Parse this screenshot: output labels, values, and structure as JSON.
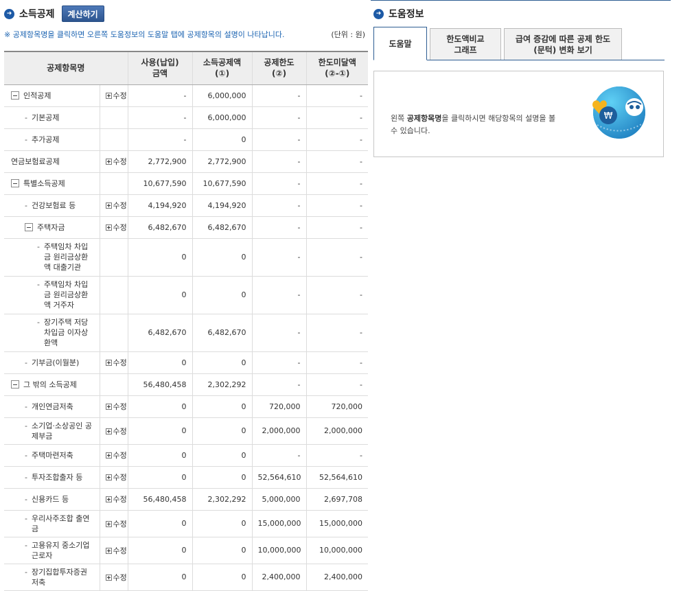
{
  "header": {
    "title": "소득공제",
    "calc_button": "계산하기",
    "note": "※ 공제항목명을 클릭하면 오른쪽 도움정보의 도움말 탭에 공제항목의 설명이 나타납니다.",
    "unit": "(단위 : 원)"
  },
  "table": {
    "headers": {
      "item": "공제항목명",
      "used_1": "사용(납입)",
      "used_2": "금액",
      "deduct_1": "소득공제액",
      "deduct_2": "(①)",
      "limit_1": "공제한도",
      "limit_2": "(②)",
      "remain_1": "한도미달액",
      "remain_2": "(②-①)"
    },
    "edit_label": "수정",
    "rows": [
      {
        "name": "인적공제",
        "used": "-",
        "deduct": "6,000,000",
        "limit": "-",
        "remain": "-"
      },
      {
        "name": "기본공제",
        "used": "-",
        "deduct": "6,000,000",
        "limit": "-",
        "remain": "-"
      },
      {
        "name": "추가공제",
        "used": "-",
        "deduct": "0",
        "limit": "-",
        "remain": "-"
      },
      {
        "name": "연금보험료공제",
        "used": "2,772,900",
        "deduct": "2,772,900",
        "limit": "-",
        "remain": "-"
      },
      {
        "name": "특별소득공제",
        "used": "10,677,590",
        "deduct": "10,677,590",
        "limit": "-",
        "remain": "-"
      },
      {
        "name": "건강보험료 등",
        "used": "4,194,920",
        "deduct": "4,194,920",
        "limit": "-",
        "remain": "-"
      },
      {
        "name": "주택자금",
        "used": "6,482,670",
        "deduct": "6,482,670",
        "limit": "-",
        "remain": "-"
      },
      {
        "name": "주택임차 차입금 원리금상환액 대출기관",
        "used": "0",
        "deduct": "0",
        "limit": "-",
        "remain": "-"
      },
      {
        "name": "주택임차 차입금 원리금상환액 거주자",
        "used": "0",
        "deduct": "0",
        "limit": "-",
        "remain": "-"
      },
      {
        "name": "장기주택 저당차입금 이자상환액",
        "used": "6,482,670",
        "deduct": "6,482,670",
        "limit": "-",
        "remain": "-"
      },
      {
        "name": "기부금(이월분)",
        "used": "0",
        "deduct": "0",
        "limit": "-",
        "remain": "-"
      },
      {
        "name": "그 밖의 소득공제",
        "used": "56,480,458",
        "deduct": "2,302,292",
        "limit": "-",
        "remain": "-"
      },
      {
        "name": "개인연금저축",
        "used": "0",
        "deduct": "0",
        "limit": "720,000",
        "remain": "720,000"
      },
      {
        "name": "소기업·소상공인 공제부금",
        "used": "0",
        "deduct": "0",
        "limit": "2,000,000",
        "remain": "2,000,000"
      },
      {
        "name": "주택마련저축",
        "used": "0",
        "deduct": "0",
        "limit": "-",
        "remain": "-"
      },
      {
        "name": "투자조합출자 등",
        "used": "0",
        "deduct": "0",
        "limit": "52,564,610",
        "remain": "52,564,610"
      },
      {
        "name": "신용카드 등",
        "used": "56,480,458",
        "deduct": "2,302,292",
        "limit": "5,000,000",
        "remain": "2,697,708"
      },
      {
        "name": "우리사주조합 출연금",
        "used": "0",
        "deduct": "0",
        "limit": "15,000,000",
        "remain": "15,000,000"
      },
      {
        "name": "고용유지 중소기업 근로자",
        "used": "0",
        "deduct": "0",
        "limit": "10,000,000",
        "remain": "10,000,000"
      },
      {
        "name": "장기집합투자증권저축",
        "used": "0",
        "deduct": "0",
        "limit": "2,400,000",
        "remain": "2,400,000"
      }
    ]
  },
  "help": {
    "title": "도움정보",
    "tabs": [
      "도움말",
      "한도액비교 그래프",
      "급여 증감에 따른 공제 한도(문턱) 변화 보기"
    ],
    "text_pre": "왼쪽 ",
    "text_bold": "공제항목명",
    "text_post": "을 클릭하시면 해당항목의 설명을 볼 수 있습니다.",
    "mascot_symbol": "₩"
  },
  "colors": {
    "accent": "#2c5c92",
    "note": "#1b63b1",
    "button": "#2d558f"
  }
}
